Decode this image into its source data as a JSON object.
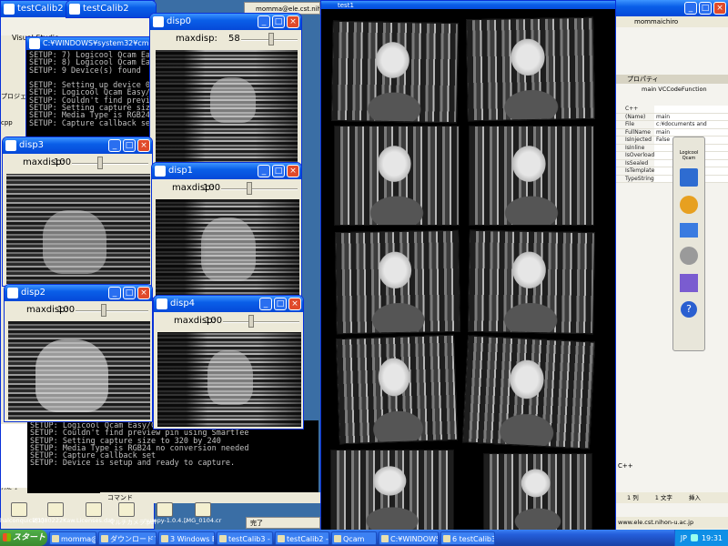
{
  "windows": {
    "console_top_title": "C:¥WINDOWS¥system32¥cmd.exe",
    "vs_label": "Visual Studio",
    "disp0_title": "disp0",
    "disp1_title": "disp1",
    "disp2_title": "disp2",
    "disp3_title": "disp3",
    "disp4_title": "disp4",
    "mosaic_title": "test1",
    "bg_left_title": "testCalib2",
    "bg_left2_title": "testCalib2"
  },
  "sliders": {
    "label": "maxdisp:",
    "disp0": "58",
    "disp1": "100",
    "disp2": "100",
    "disp3": "100",
    "disp4": "100"
  },
  "console_top": [
    "SETUP: 7) Logicool Qcam Easy/Coo",
    "SETUP: 8) Logicool Qcam Easy/Coo",
    "SETUP: 9 Device(s) found",
    "",
    "SETUP: Setting up device 0",
    "SETUP: Logicool Qcam Easy/Cool",
    "SETUP: Couldn't find preview pin",
    "SETUP: Setting capture size to 3",
    "SETUP: Media Type is RGB24 no co",
    "SETUP: Capture callback set"
  ],
  "console_bottom": [
    "SETUP: Logicool Qcam Easy/Cool",
    "SETUP: Couldn't find preview pin using SmartTee",
    "SETUP: Setting capture size to 320 by 240",
    "SETUP: Media Type is RGB24 no conversion needed",
    "SETUP: Capture callback set",
    "SETUP: Device is setup and ready to capture."
  ],
  "vs": {
    "user": "mommaichiro",
    "props_title": "プロパティ",
    "props_object": "main  VCCodeFunction",
    "rows": [
      {
        "k": "C++",
        "v": ""
      },
      {
        "k": "(Name)",
        "v": "main"
      },
      {
        "k": "File",
        "v": "c:¥documents and"
      },
      {
        "k": "FullName",
        "v": "main"
      },
      {
        "k": "IsInjected",
        "v": "False"
      },
      {
        "k": "IsInline",
        "v": ""
      },
      {
        "k": "IsOverloaded",
        "v": ""
      },
      {
        "k": "IsSealed",
        "v": ""
      },
      {
        "k": "IsTemplate",
        "v": ""
      },
      {
        "k": "TypeString",
        "v": ""
      }
    ],
    "qcam_label": "Logicool Qcam",
    "status_col": "1 列",
    "status_ch": "1 文字",
    "status_ins": "挿入",
    "url": "www.ele.cst.nihon-u.ac.jp",
    "cpp_label": "C++"
  },
  "left_panel": {
    "project_label": "プロジェ",
    "cpp": "cpp",
    "class_view": "ｸﾗｽﾋﾞｭｰ",
    "output_label": "出力",
    "command_label": "コマンド",
    "done_label": "完了"
  },
  "desktop_icons": [
    "halconquick[1]",
    "20080222Kaw...",
    "Licenses.dat",
    "マルチカメラ.pdf",
    "numpy-1.0.4...",
    "[MG_0104.cr"
  ],
  "taskbar": {
    "start": "スタート",
    "tasks": [
      "momma@ele.cst.n...",
      "ダウンロードマネージ...",
      "3 Windows Explo...",
      "testCalib3 - Micro...",
      "testCalib2 - Micro...",
      "Qcam",
      "C:¥WINDOWS¥syst...",
      "6 testCalib3"
    ],
    "tray_lang": "JP",
    "clock": "19:31"
  },
  "browser_tab": "momma@ele.cst.nihon"
}
